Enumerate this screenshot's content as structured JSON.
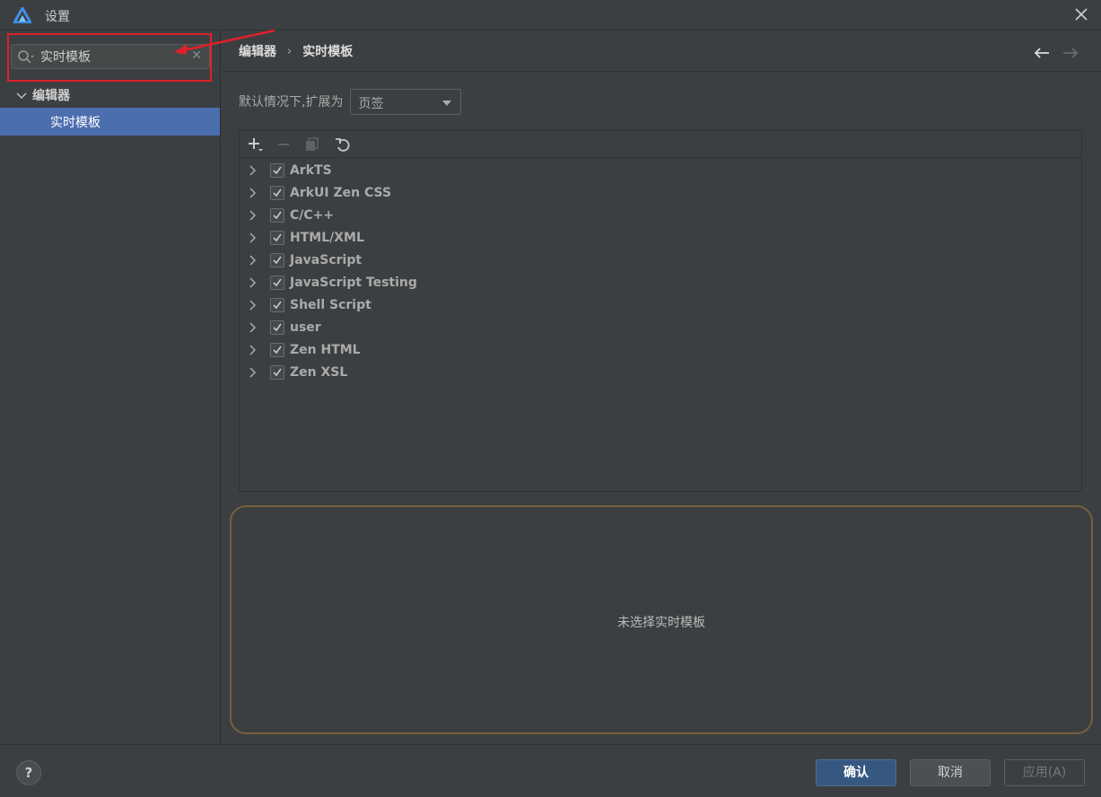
{
  "window": {
    "title": "设置"
  },
  "search": {
    "value": "实时模板",
    "clear_glyph": "✕"
  },
  "tree": {
    "group_label": "编辑器",
    "selected_item_label": "实时模板"
  },
  "breadcrumb": {
    "first": "编辑器",
    "separator": "›",
    "second": "实时模板"
  },
  "expand_setting": {
    "label": "默认情况下,扩展为",
    "selected": "页签"
  },
  "templates": [
    {
      "label": "ArkTS",
      "checked": true
    },
    {
      "label": "ArkUI Zen CSS",
      "checked": true
    },
    {
      "label": "C/C++",
      "checked": true
    },
    {
      "label": "HTML/XML",
      "checked": true
    },
    {
      "label": "JavaScript",
      "checked": true
    },
    {
      "label": "JavaScript Testing",
      "checked": true
    },
    {
      "label": "Shell Script",
      "checked": true
    },
    {
      "label": "user",
      "checked": true
    },
    {
      "label": "Zen HTML",
      "checked": true
    },
    {
      "label": "Zen XSL",
      "checked": true
    }
  ],
  "detail": {
    "empty_text": "未选择实时模板"
  },
  "footer": {
    "help_label": "?",
    "ok_label": "确认",
    "cancel_label": "取消",
    "apply_label": "应用(A)"
  },
  "colors": {
    "background": "#3c3f41",
    "selection": "#4b6eaf",
    "primary_button": "#365880",
    "annotation": "#e0202a"
  }
}
